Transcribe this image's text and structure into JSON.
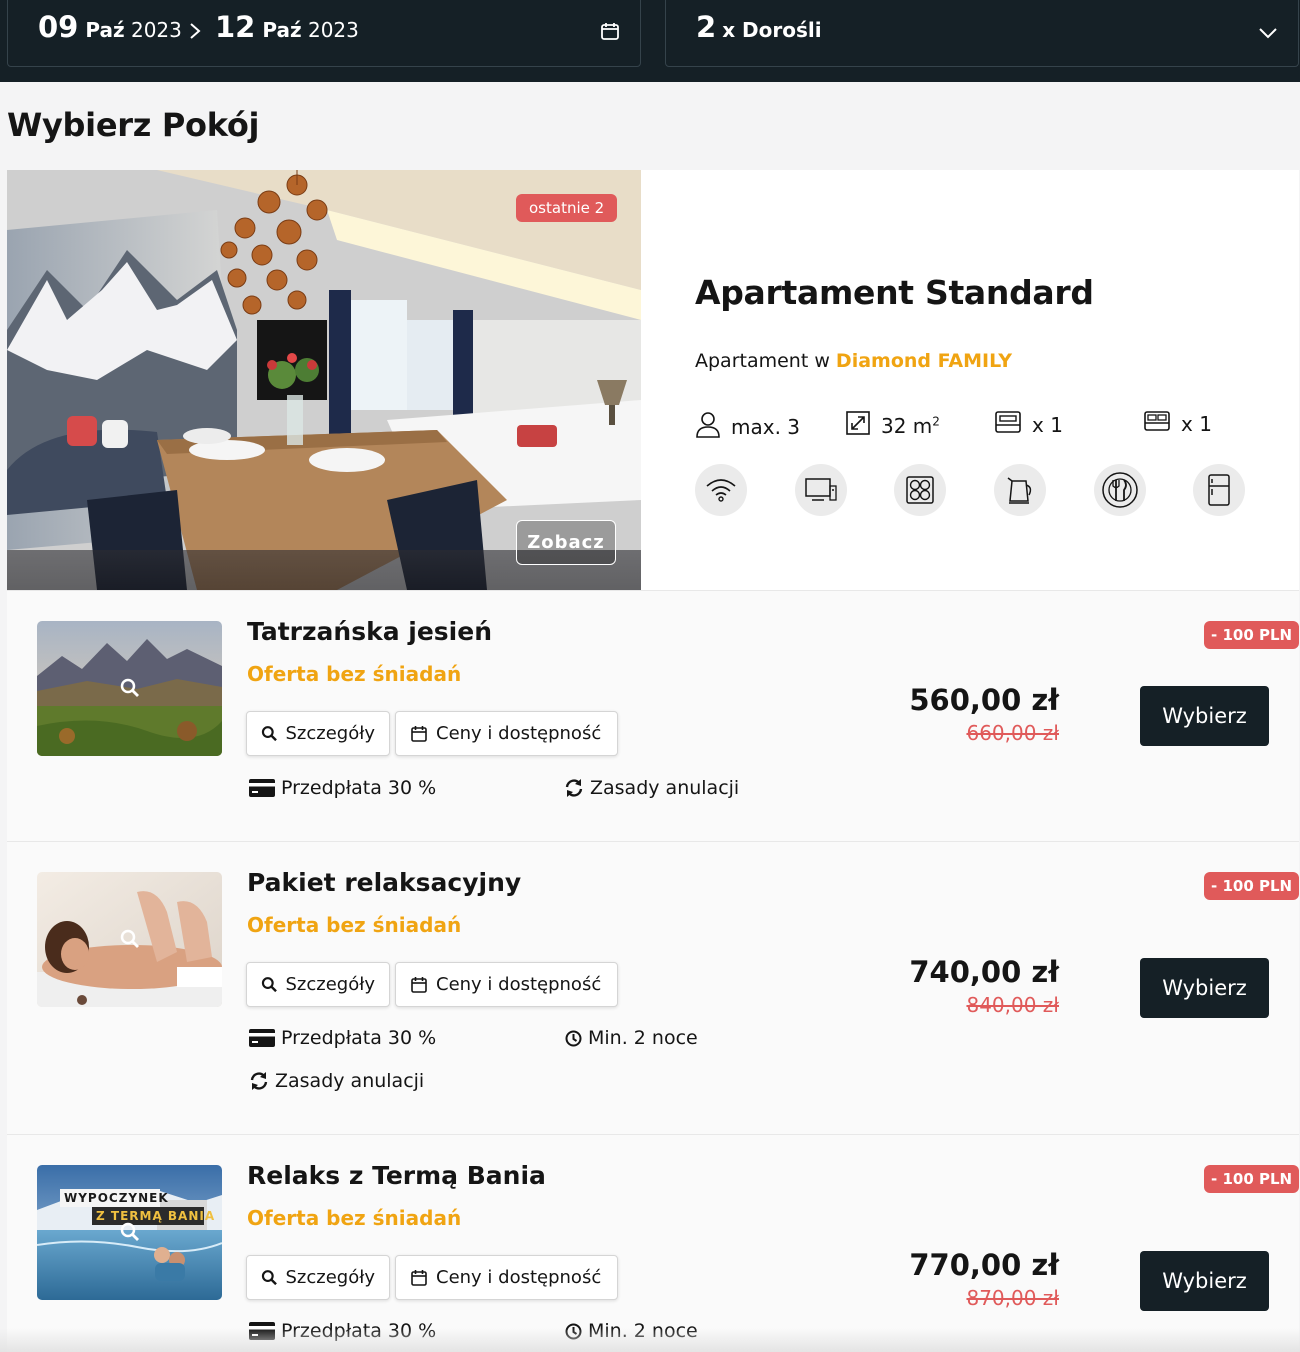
{
  "search": {
    "checkin_day": "09",
    "checkin_month": "Paź",
    "checkin_year": "2023",
    "checkout_day": "12",
    "checkout_month": "Paź",
    "checkout_year": "2023",
    "guests_count": "2",
    "guests_label": "x Dorośli"
  },
  "page_title": "Wybierz Pokój",
  "room": {
    "badge": "ostatnie 2",
    "see_button": "Zobacz",
    "name": "Apartament Standard",
    "subtitle_prefix": "Apartament w",
    "subtitle_highlight": "Diamond FAMILY",
    "features": {
      "max_guests": "max. 3",
      "area": "32 m",
      "area_sup": "2",
      "single_bed": "x 1",
      "double_bed": "x 1"
    },
    "amenities": [
      "wifi-icon",
      "tv-icon",
      "stove-icon",
      "kettle-icon",
      "dining-icon",
      "fridge-icon"
    ]
  },
  "offers": [
    {
      "title": "Tatrzańska jesień",
      "subtitle": "Oferta bez śniadań",
      "details_label": "Szczegóły",
      "prices_label": "Ceny i dostępność",
      "prepay": "Przedpłata 30 %",
      "cancel": "Zasady anulacji",
      "discount": "- 100 PLN",
      "price": "560,00 zł",
      "old_price": "660,00 zł",
      "choose_label": "Wybierz"
    },
    {
      "title": "Pakiet relaksacyjny",
      "subtitle": "Oferta bez śniadań",
      "details_label": "Szczegóły",
      "prices_label": "Ceny i dostępność",
      "prepay": "Przedpłata 30 %",
      "min_nights": "Min. 2 noce",
      "cancel": "Zasady anulacji",
      "discount": "- 100 PLN",
      "price": "740,00 zł",
      "old_price": "840,00 zł",
      "choose_label": "Wybierz"
    },
    {
      "title": "Relaks z Termą Bania",
      "subtitle": "Oferta bez śniadań",
      "details_label": "Szczegóły",
      "prices_label": "Ceny i dostępność",
      "prepay": "Przedpłata 30 %",
      "min_nights": "Min. 2 noce",
      "thumb_line1": "WYPOCZYNEK",
      "thumb_line2": "Z TERMĄ BANIA",
      "discount": "- 100 PLN",
      "price": "770,00 zł",
      "old_price": "870,00 zł",
      "choose_label": "Wybierz"
    }
  ],
  "colors": {
    "header_bg": "#152026",
    "accent": "#f0a412",
    "discount": "#e05a5a"
  }
}
